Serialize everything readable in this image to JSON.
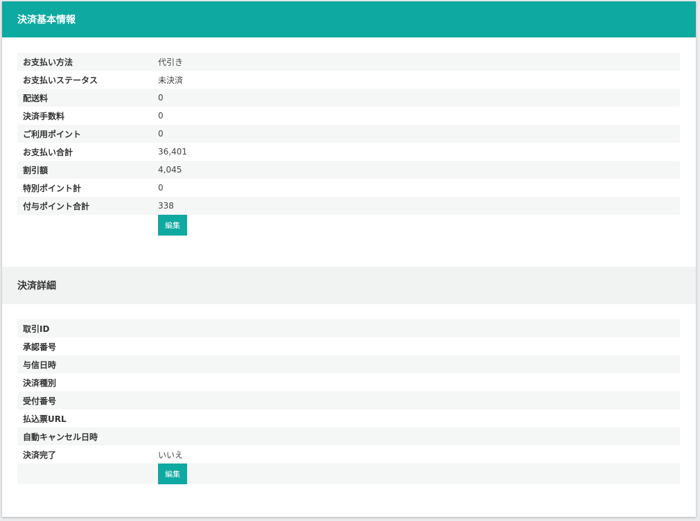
{
  "basic": {
    "title": "決済基本情報",
    "rows": [
      {
        "label": "お支払い方法",
        "value": "代引き"
      },
      {
        "label": "お支払いステータス",
        "value": "未決済"
      },
      {
        "label": "配送料",
        "value": "0"
      },
      {
        "label": "決済手数料",
        "value": "0"
      },
      {
        "label": "ご利用ポイント",
        "value": "0"
      },
      {
        "label": "お支払い合計",
        "value": "36,401"
      },
      {
        "label": "割引額",
        "value": "4,045"
      },
      {
        "label": "特別ポイント計",
        "value": "0"
      },
      {
        "label": "付与ポイント合計",
        "value": "338"
      }
    ],
    "edit_label": "編集"
  },
  "detail": {
    "title": "決済詳細",
    "rows": [
      {
        "label": "取引ID",
        "value": ""
      },
      {
        "label": "承認番号",
        "value": ""
      },
      {
        "label": "与信日時",
        "value": ""
      },
      {
        "label": "決済種別",
        "value": ""
      },
      {
        "label": "受付番号",
        "value": ""
      },
      {
        "label": "払込票URL",
        "value": ""
      },
      {
        "label": "自動キャンセル日時",
        "value": ""
      },
      {
        "label": "決済完了",
        "value": "いいえ"
      }
    ],
    "edit_label": "編集"
  },
  "colors": {
    "accent": "#0ea9a0",
    "row_alt": "#f5f6f6"
  }
}
